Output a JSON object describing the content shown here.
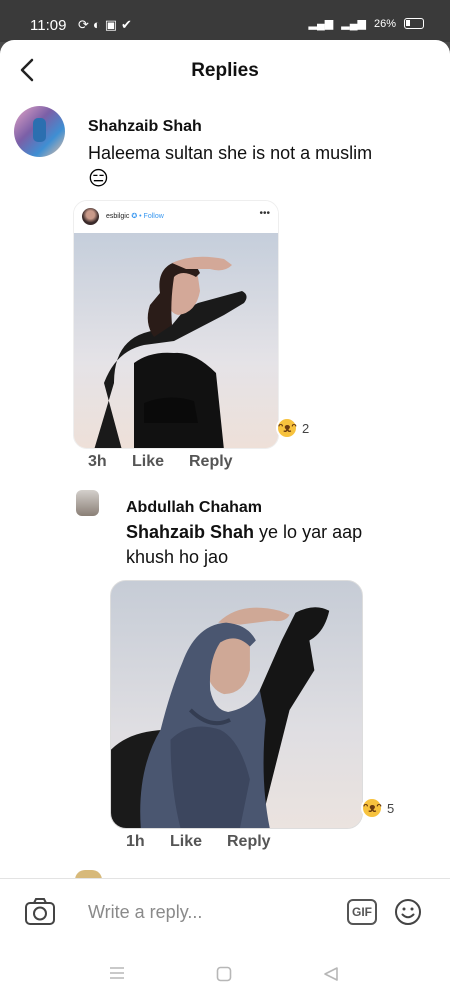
{
  "status_bar": {
    "time": "11:09",
    "battery": "26%"
  },
  "header": {
    "title": "Replies"
  },
  "comment1": {
    "author": "Shahzaib Shah",
    "text": "Haleema sultan she is not a muslim",
    "emoji": "😑",
    "embedded_post": {
      "username": "esbilgic",
      "follow": "Follow"
    },
    "reaction_count": "2",
    "time": "3h",
    "like": "Like",
    "reply": "Reply"
  },
  "comment2": {
    "author": "Abdullah Chaham",
    "mention": "Shahzaib Shah",
    "text_line1": "ye lo yar aap",
    "text_line2": "khush ho jao",
    "reaction_count": "5",
    "time": "1h",
    "like": "Like",
    "reply": "Reply"
  },
  "composer": {
    "placeholder": "Write a reply...",
    "gif_label": "GIF"
  },
  "colors": {
    "link_blue": "#3897f0",
    "reaction_yellow": "#f7c23e"
  },
  "icons": [
    "back-arrow-icon",
    "camera-icon",
    "gif-icon",
    "emoji-icon",
    "menu-icon",
    "home-icon",
    "back-triangle-icon"
  ]
}
